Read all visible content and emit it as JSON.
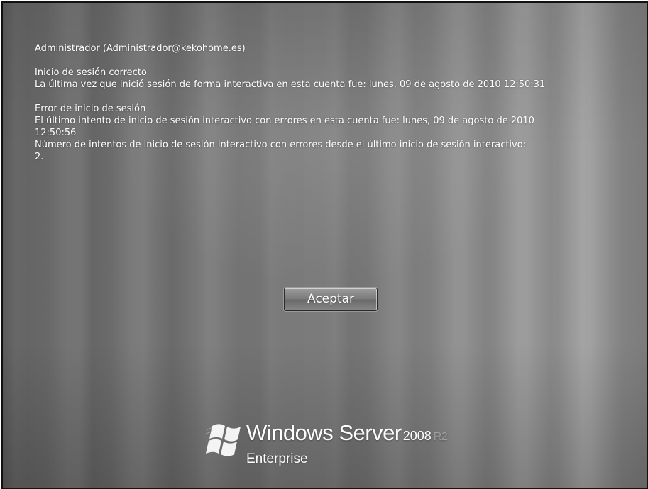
{
  "messages": {
    "account": "Administrador (Administrador@kekohome.es)",
    "success": {
      "heading": "Inicio de sesión correcto",
      "detail": "La última vez que inició sesión de forma interactiva en esta cuenta fue: lunes, 09 de agosto de 2010 12:50:31"
    },
    "failure": {
      "heading": "Error de inicio de sesión",
      "detail_line1": "El último intento de inicio de sesión interactivo con errores en esta cuenta fue: lunes, 09 de agosto de 2010",
      "detail_line2": "12:50:56",
      "count_line1": "Número de intentos de inicio de sesión interactivo con errores desde el último inicio de sesión interactivo:",
      "count_line2": "2."
    }
  },
  "ok_button": {
    "label": "Aceptar"
  },
  "branding": {
    "logo_icon": "windows-flag-icon",
    "product": "Windows Server",
    "version": "2008",
    "release": "R2",
    "edition": "Enterprise"
  },
  "colors": {
    "text": "#ffffff",
    "border": "#111111"
  }
}
